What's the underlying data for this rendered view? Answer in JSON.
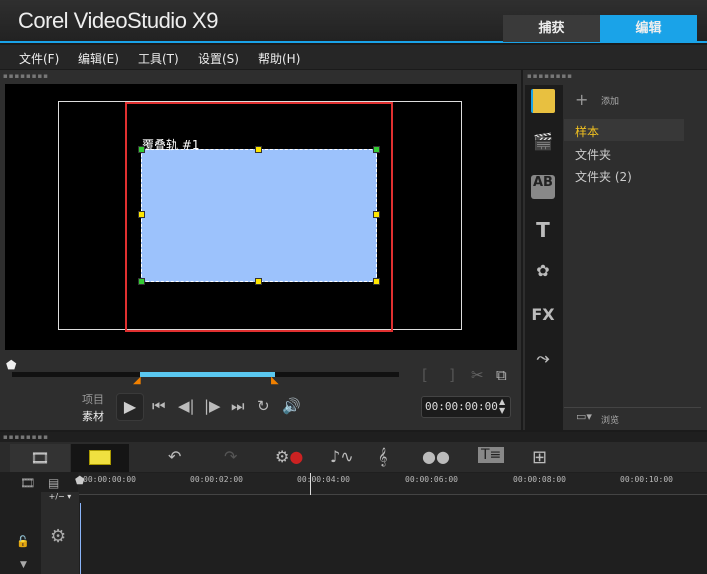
{
  "app": {
    "logo": "Corel VideoStudio X9",
    "tabs": [
      {
        "label": "捕获"
      },
      {
        "label": "编辑"
      }
    ]
  },
  "menu": [
    "文件(F)",
    "编辑(E)",
    "工具(T)",
    "设置(S)",
    "帮助(H)"
  ],
  "preview": {
    "overlay_label": "覆叠轨 #1",
    "mode_project": "项目",
    "mode_clip": "素材",
    "timecode": "00:00:00:00"
  },
  "library": {
    "add_label": "添加",
    "folders": [
      "样本",
      "文件夹",
      "文件夹 (2)"
    ],
    "browse_label": "浏览"
  },
  "timeline": {
    "ticks": [
      "00:00:00:00",
      "00:00:02:00",
      "00:00:04:00",
      "00:00:06:00",
      "00:00:08:00",
      "00:00:10:00"
    ],
    "zoom_label": "+/− ▾"
  },
  "colors": {
    "accent": "#1aa3e8",
    "selected_folder": "#f0c020",
    "overlay": "#9cc2fc",
    "frame": "#e03030"
  }
}
